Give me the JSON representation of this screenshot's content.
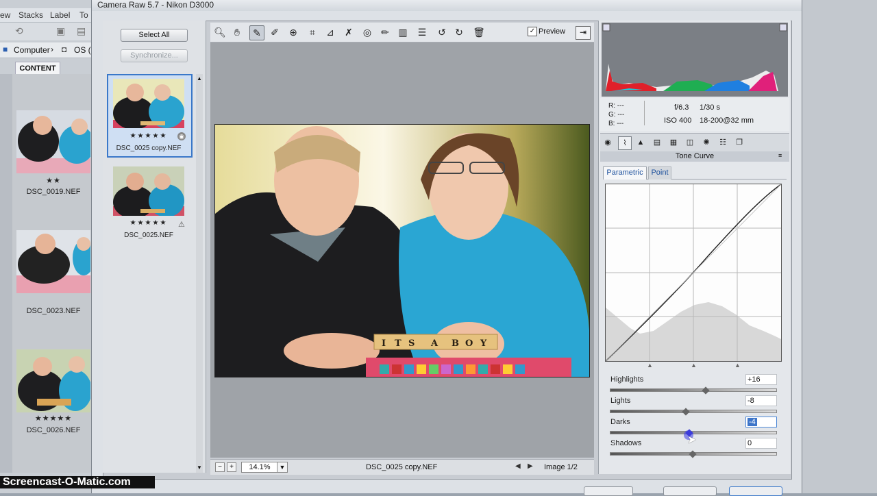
{
  "window": {
    "title": "Camera Raw 5.7  -  Nikon D3000"
  },
  "bridge": {
    "menu": [
      "ew",
      "Stacks",
      "Label",
      "To"
    ],
    "path": [
      "Computer",
      "OS ("
    ],
    "content_tab": "CONTENT",
    "items": [
      {
        "label": "DSC_0019.NEF",
        "stars": "★★"
      },
      {
        "label": "DSC_0023.NEF",
        "stars": ""
      },
      {
        "label": "DSC_0026.NEF",
        "stars": "★★★★★"
      }
    ]
  },
  "filmstrip": {
    "select_all": "Select All",
    "synchronize": "Synchronize...",
    "items": [
      {
        "label": "DSC_0025 copy.NEF",
        "stars": "★★★★★",
        "selected": true
      },
      {
        "label": "DSC_0025.NEF",
        "stars": "★★★★★",
        "selected": false
      }
    ]
  },
  "toolbar": {
    "tools": [
      "zoom-icon",
      "hand-icon",
      "white-balance-icon",
      "color-sampler-icon",
      "target-adjust-icon",
      "crop-icon",
      "straighten-icon",
      "spot-removal-icon",
      "red-eye-icon",
      "adjustment-brush-icon",
      "graduated-filter-icon",
      "preferences-icon",
      "rotate-left-icon",
      "rotate-right-icon",
      "trash-icon"
    ],
    "preview_label": "Preview",
    "preview_checked": true
  },
  "status": {
    "zoom": "14.1%",
    "filename": "DSC_0025 copy.NEF",
    "image_counter": "Image 1/2"
  },
  "readout": {
    "r": "R:  ---",
    "g": "G:  ---",
    "b": "B:  ---",
    "aperture": "f/6.3",
    "shutter": "1/30 s",
    "iso": "ISO 400",
    "lens": "18-200@32 mm"
  },
  "panel": {
    "section_title": "Tone Curve",
    "subtabs": [
      "Parametric",
      "Point"
    ],
    "active_subtab": "Parametric",
    "sliders": [
      {
        "label": "Highlights",
        "value": "+16",
        "level": 0.58
      },
      {
        "label": "Lights",
        "value": "-8",
        "level": 0.46
      },
      {
        "label": "Darks",
        "value": "-4",
        "level": 0.48,
        "active": true
      },
      {
        "label": "Shadows",
        "value": "0",
        "level": 0.5
      }
    ]
  },
  "watermark": "Screencast-O-Matic.com",
  "colors": {
    "accent": "#3a78c9",
    "selection": "#cfdff3"
  }
}
